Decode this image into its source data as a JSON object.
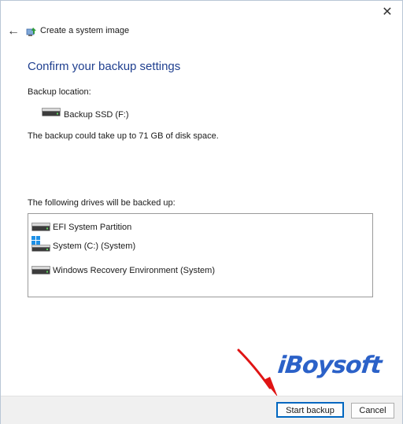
{
  "window": {
    "title": "Create a system image",
    "close_glyph": "✕",
    "back_glyph": "←"
  },
  "main": {
    "heading": "Confirm your backup settings",
    "backup_location_label": "Backup location:",
    "backup_location_drive": "Backup SSD (F:)",
    "space_text": "The backup could take up to 71 GB of disk space.",
    "drives_label": "The following drives will be backed up:",
    "drives": [
      {
        "name": "EFI System Partition",
        "icon": "drive-icon"
      },
      {
        "name": "System (C:) (System)",
        "icon": "windows-drive-icon"
      },
      {
        "name": "Windows Recovery Environment (System)",
        "icon": "drive-icon"
      }
    ]
  },
  "footer": {
    "start_label": "Start backup",
    "cancel_label": "Cancel"
  },
  "watermark": {
    "text": "iBoysoft"
  },
  "colors": {
    "heading": "#1f3f8f",
    "accent": "#0067c0",
    "arrow": "#e01414",
    "watermark": "#2b61c8"
  }
}
